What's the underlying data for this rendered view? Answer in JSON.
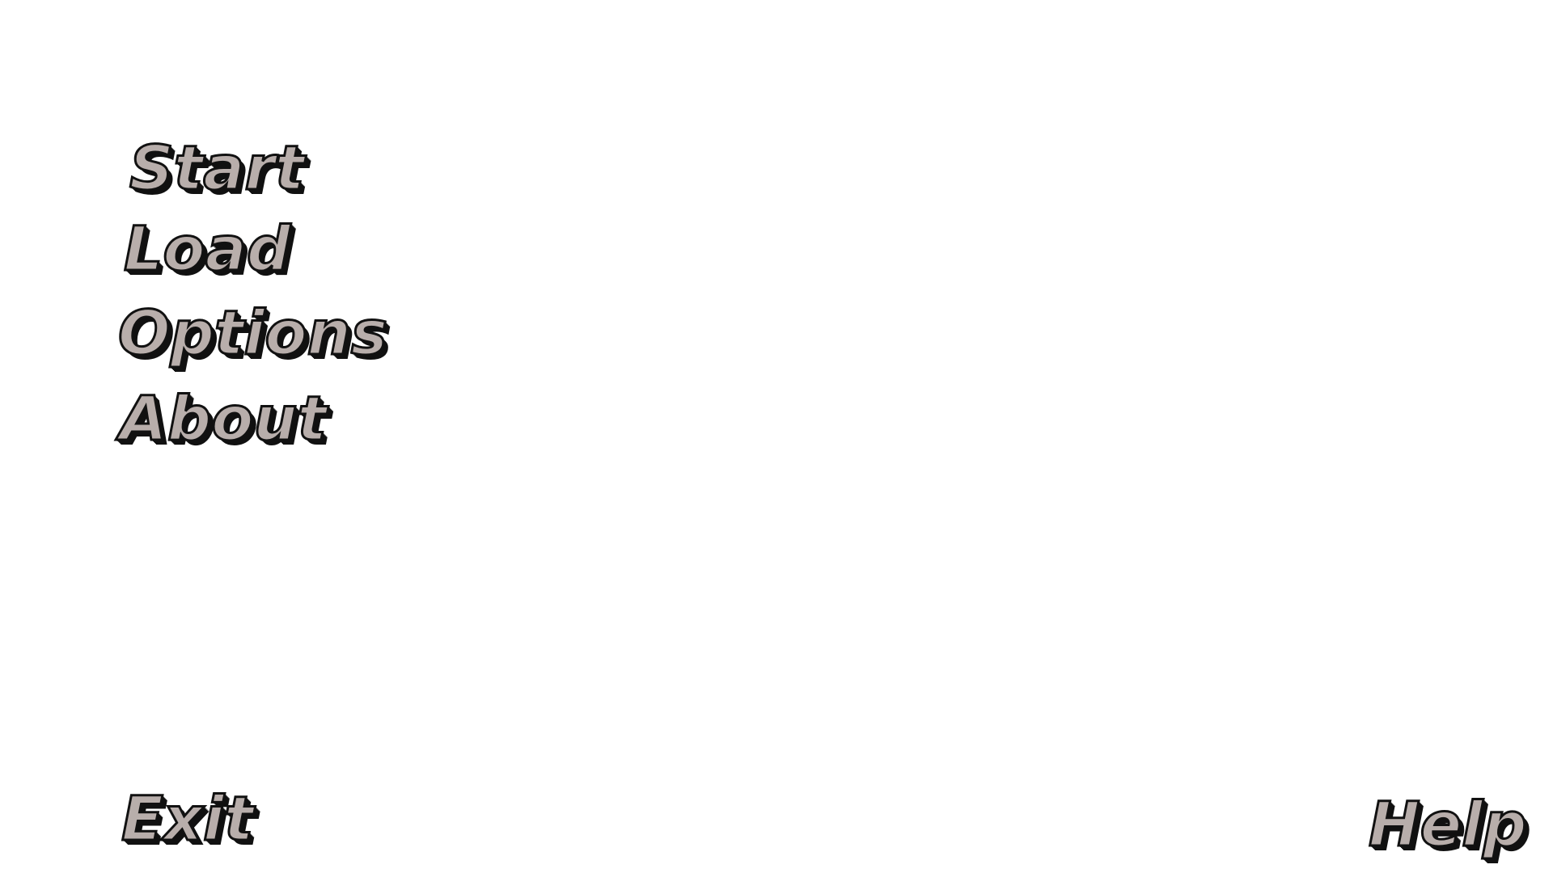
{
  "main_menu": {
    "items": [
      {
        "id": "start",
        "label": "Start"
      },
      {
        "id": "load",
        "label": "Load"
      },
      {
        "id": "options",
        "label": "Options"
      },
      {
        "id": "about",
        "label": "About"
      }
    ]
  },
  "footer": {
    "exit_label": "Exit",
    "help_label": "Help"
  },
  "colors": {
    "background": "#ffffff",
    "text_fill": "#b8aeab",
    "text_outline": "#111111"
  }
}
